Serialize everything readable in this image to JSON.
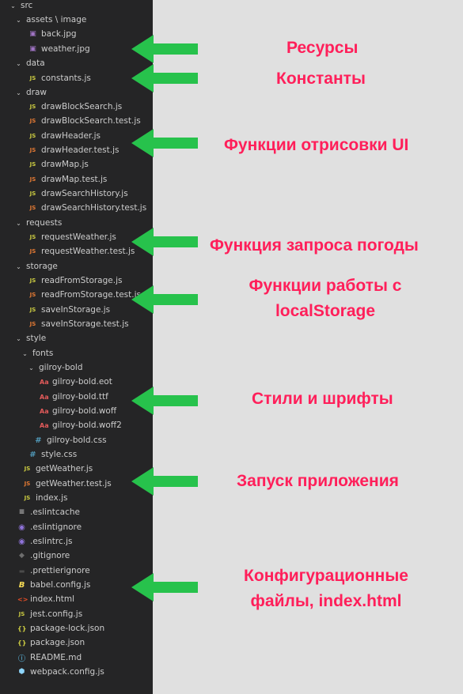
{
  "explorer": {
    "items": [
      {
        "label": "src",
        "type": "folder",
        "icon": "chevron-down-icon"
      },
      {
        "label": "assets \\ image",
        "type": "folder",
        "icon": "chevron-down-icon"
      },
      {
        "label": "back.jpg",
        "type": "file",
        "icon": "image-file-icon"
      },
      {
        "label": "weather.jpg",
        "type": "file",
        "icon": "image-file-icon"
      },
      {
        "label": "data",
        "type": "folder",
        "icon": "chevron-down-icon"
      },
      {
        "label": "constants.js",
        "type": "file",
        "icon": "js-file-icon"
      },
      {
        "label": "draw",
        "type": "folder",
        "icon": "chevron-down-icon"
      },
      {
        "label": "drawBlockSearch.js",
        "type": "file",
        "icon": "js-file-icon"
      },
      {
        "label": "drawBlockSearch.test.js",
        "type": "file",
        "icon": "js-test-file-icon"
      },
      {
        "label": "drawHeader.js",
        "type": "file",
        "icon": "js-file-icon"
      },
      {
        "label": "drawHeader.test.js",
        "type": "file",
        "icon": "js-test-file-icon"
      },
      {
        "label": "drawMap.js",
        "type": "file",
        "icon": "js-file-icon"
      },
      {
        "label": "drawMap.test.js",
        "type": "file",
        "icon": "js-test-file-icon"
      },
      {
        "label": "drawSearchHistory.js",
        "type": "file",
        "icon": "js-file-icon"
      },
      {
        "label": "drawSearchHistory.test.js",
        "type": "file",
        "icon": "js-test-file-icon"
      },
      {
        "label": "requests",
        "type": "folder",
        "icon": "chevron-down-icon"
      },
      {
        "label": "requestWeather.js",
        "type": "file",
        "icon": "js-file-icon"
      },
      {
        "label": "requestWeather.test.js",
        "type": "file",
        "icon": "js-test-file-icon"
      },
      {
        "label": "storage",
        "type": "folder",
        "icon": "chevron-down-icon"
      },
      {
        "label": "readFromStorage.js",
        "type": "file",
        "icon": "js-file-icon"
      },
      {
        "label": "readFromStorage.test.js",
        "type": "file",
        "icon": "js-test-file-icon"
      },
      {
        "label": "saveInStorage.js",
        "type": "file",
        "icon": "js-file-icon"
      },
      {
        "label": "saveInStorage.test.js",
        "type": "file",
        "icon": "js-test-file-icon"
      },
      {
        "label": "style",
        "type": "folder",
        "icon": "chevron-down-icon"
      },
      {
        "label": "fonts",
        "type": "folder",
        "icon": "chevron-down-icon"
      },
      {
        "label": "gilroy-bold",
        "type": "folder",
        "icon": "chevron-down-icon"
      },
      {
        "label": "gilroy-bold.eot",
        "type": "file",
        "icon": "font-file-icon"
      },
      {
        "label": "gilroy-bold.ttf",
        "type": "file",
        "icon": "font-file-icon"
      },
      {
        "label": "gilroy-bold.woff",
        "type": "file",
        "icon": "font-file-icon"
      },
      {
        "label": "gilroy-bold.woff2",
        "type": "file",
        "icon": "font-file-icon"
      },
      {
        "label": "gilroy-bold.css",
        "type": "file",
        "icon": "css-file-icon"
      },
      {
        "label": "style.css",
        "type": "file",
        "icon": "css-file-icon"
      },
      {
        "label": "getWeather.js",
        "type": "file",
        "icon": "js-file-icon"
      },
      {
        "label": "getWeather.test.js",
        "type": "file",
        "icon": "js-test-file-icon"
      },
      {
        "label": "index.js",
        "type": "file",
        "icon": "js-file-icon"
      },
      {
        "label": ".eslintcache",
        "type": "file",
        "icon": "text-file-icon"
      },
      {
        "label": ".eslintignore",
        "type": "file",
        "icon": "eslint-file-icon"
      },
      {
        "label": ".eslintrc.js",
        "type": "file",
        "icon": "eslint-file-icon"
      },
      {
        "label": ".gitignore",
        "type": "file",
        "icon": "git-file-icon"
      },
      {
        "label": ".prettierignore",
        "type": "file",
        "icon": "prettier-file-icon"
      },
      {
        "label": "babel.config.js",
        "type": "file",
        "icon": "babel-file-icon"
      },
      {
        "label": "index.html",
        "type": "file",
        "icon": "html-file-icon"
      },
      {
        "label": "jest.config.js",
        "type": "file",
        "icon": "js-file-icon"
      },
      {
        "label": "package-lock.json",
        "type": "file",
        "icon": "json-file-icon"
      },
      {
        "label": "package.json",
        "type": "file",
        "icon": "json-file-icon"
      },
      {
        "label": "README.md",
        "type": "file",
        "icon": "info-file-icon"
      },
      {
        "label": "webpack.config.js",
        "type": "file",
        "icon": "webpack-file-icon"
      }
    ]
  },
  "annotations": [
    {
      "text": "Ресурсы"
    },
    {
      "text": "Константы"
    },
    {
      "text": "Функции  отрисовки UI"
    },
    {
      "text": "Функция  запроса погоды"
    },
    {
      "text": "Функции  работы с localStorage"
    },
    {
      "text": "Стили и шрифты"
    },
    {
      "text": "Запуск приложения"
    },
    {
      "text": "Конфигурационные файлы, index.html"
    }
  ],
  "colors": {
    "sidebar_bg": "#252526",
    "canvas_bg": "#e0e0e0",
    "annotation_text": "#ff1f5a",
    "arrow": "#27c24c"
  }
}
